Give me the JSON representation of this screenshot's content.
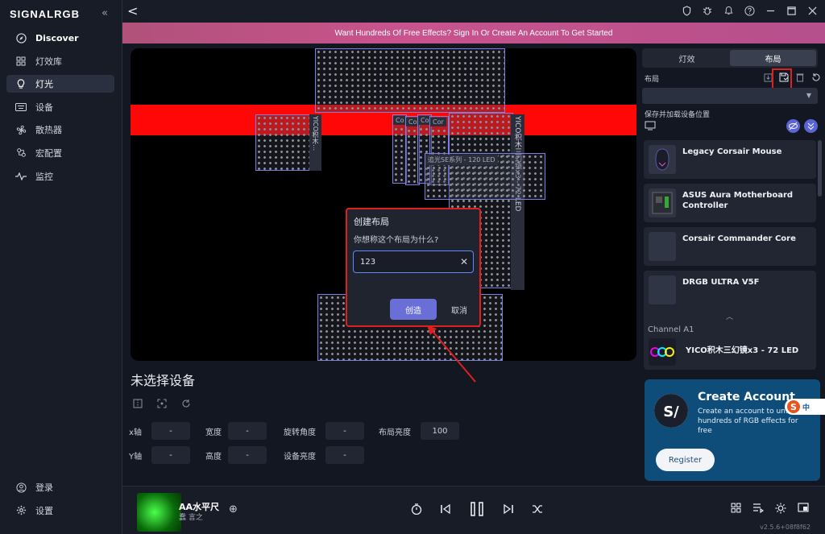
{
  "app": {
    "logo": "SIGNALRGB",
    "collapse_icon": "«"
  },
  "sidebar": {
    "items": [
      {
        "label": "Discover",
        "icon": "compass-icon"
      },
      {
        "label": "灯效库",
        "icon": "grid-icon"
      },
      {
        "label": "灯光",
        "icon": "bulb-icon",
        "active": true
      },
      {
        "label": "设备",
        "icon": "keyboard-icon"
      },
      {
        "label": "散热器",
        "icon": "fan-icon"
      },
      {
        "label": "宏配置",
        "icon": "macro-icon"
      },
      {
        "label": "监控",
        "icon": "pulse-icon"
      }
    ],
    "bottom": [
      {
        "label": "登录",
        "icon": "user-icon"
      },
      {
        "label": "设置",
        "icon": "gear-icon"
      }
    ]
  },
  "topbar": {
    "back": "<"
  },
  "banner": {
    "text": "Want Hundreds Of Free Effects? Sign In Or Create An Account To Get Started"
  },
  "canvas": {
    "labels": {
      "yico_small": "YICO积木…",
      "yico_big": "YICO积木三幻镜x3 - 72 LED",
      "strip": "追光SE系列 - 120 LED",
      "co1": "Co",
      "co2": "Co",
      "co3": "Co",
      "cor": "Cor"
    }
  },
  "dialog": {
    "title": "创建布局",
    "question": "你想称这个布局为什么?",
    "input_value": "123",
    "create": "创造",
    "cancel": "取消"
  },
  "device_panel": {
    "title": "未选择设备",
    "props": {
      "x_label": "x轴",
      "x_value": "-",
      "y_label": "Y轴",
      "y_value": "-",
      "w_label": "宽度",
      "w_value": "-",
      "h_label": "高度",
      "h_value": "-",
      "rot_label": "旋转角度",
      "rot_value": "-",
      "dev_bright_label": "设备亮度",
      "dev_bright_value": "-",
      "layout_bright_label": "布局亮度",
      "layout_bright_value": "100"
    }
  },
  "right_panel": {
    "tabs": [
      "灯效",
      "布局"
    ],
    "active_tab": "布局",
    "layout_label": "布局",
    "saveload": "保存并加载设备位置",
    "devices": [
      "Legacy Corsair Mouse",
      "ASUS Aura Motherboard Controller",
      "Corsair Commander Core",
      "DRGB ULTRA V5F"
    ],
    "channel": "Channel A1",
    "channel_device": "YICO积木三幻镜x3 - 72 LED"
  },
  "promo": {
    "title": "Create Account",
    "body": "Create an account to un... hundreds of RGB effects for free",
    "register": "Register"
  },
  "ime": {
    "text": "中"
  },
  "player": {
    "song": "AA水平尺",
    "artist": "蠢 言之",
    "version": "v2.5.6+08f8f62"
  },
  "colors": {
    "accent": "#6a6fd8",
    "highlight": "#e02020",
    "red_strip": "#ff0707",
    "banner": "#c9538d"
  }
}
